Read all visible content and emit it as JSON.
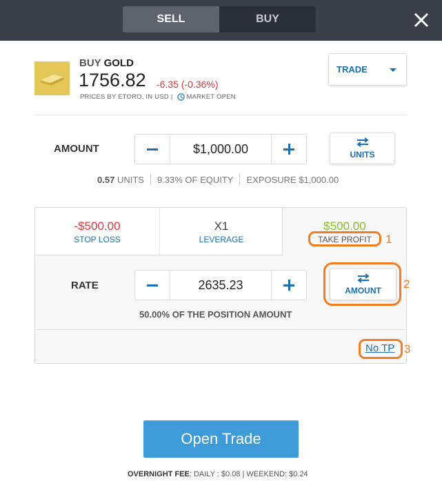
{
  "tabs": {
    "sell": "SELL",
    "buy": "BUY"
  },
  "instrument": {
    "action": "BUY",
    "symbol": "GOLD",
    "price": "1756.82",
    "change": "-6.35 (-0.36%)",
    "price_source": "PRICES BY ETORO, IN USD",
    "market_status": "MARKET OPEN"
  },
  "order_type": {
    "selected": "TRADE"
  },
  "amount": {
    "label": "AMOUNT",
    "value": "$1,000.00",
    "switch_label": "UNITS",
    "units": "0.57",
    "units_suffix": "UNITS",
    "equity": "9.33% OF EQUITY",
    "exposure": "EXPOSURE $1,000.00"
  },
  "risk_tabs": {
    "stop_loss": {
      "value": "-$500.00",
      "label": "STOP LOSS"
    },
    "leverage": {
      "value": "X1",
      "label": "LEVERAGE"
    },
    "take_profit": {
      "value": "$500.00",
      "label": "TAKE PROFIT"
    }
  },
  "rate": {
    "label": "RATE",
    "value": "2635.23",
    "switch_label": "AMOUNT",
    "position_info": "50.00% OF THE POSITION AMOUNT"
  },
  "no_tp_link": "No TP",
  "annotations": [
    "1",
    "2",
    "3"
  ],
  "open_trade_label": "Open Trade",
  "fees": {
    "label": "OVERNIGHT FEE",
    "daily": ": DAILY : $0.08",
    "weekend": "WEEKEND: $0.24"
  },
  "colors": {
    "accent": "#1a6fb3",
    "negative": "#e0373c",
    "positive": "#8bbf2e",
    "highlight": "#f47c20",
    "primary_button": "#3d9bd8"
  }
}
